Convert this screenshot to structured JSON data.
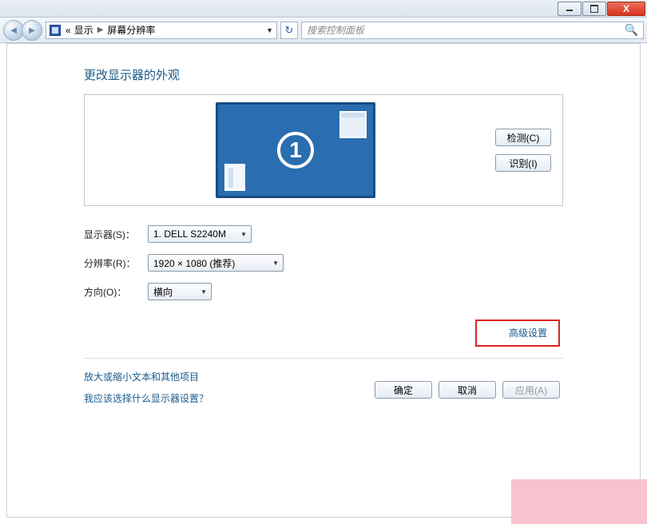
{
  "titlebar": {
    "close": "X"
  },
  "breadcrumb": {
    "back_chevrons": "«",
    "item1": "显示",
    "item2": "屏幕分辨率",
    "sep": "▶"
  },
  "search": {
    "placeholder": "搜索控制面板"
  },
  "page": {
    "title": "更改显示器的外观",
    "monitor_number": "1",
    "detect": "检测(C)",
    "identify": "识别(I)",
    "display_label": "显示器(S)：",
    "display_value": "1. DELL S2240M",
    "resolution_label": "分辨率(R)：",
    "resolution_value": "1920 × 1080 (推荐)",
    "orientation_label": "方向(O)：",
    "orientation_value": "横向",
    "advanced": "高级设置",
    "link_scale": "放大或缩小文本和其他项目",
    "link_which": "我应该选择什么显示器设置？",
    "ok": "确定",
    "cancel": "取消",
    "apply": "应用(A)"
  }
}
